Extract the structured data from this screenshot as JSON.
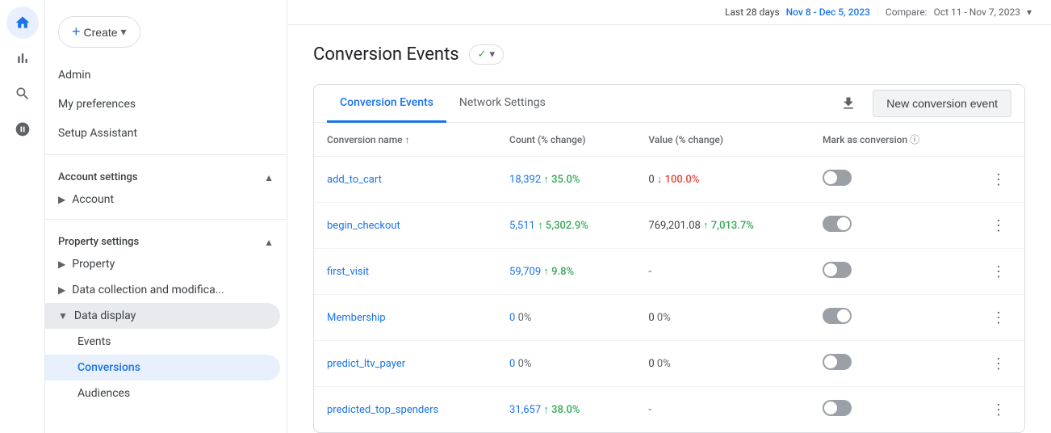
{
  "nav": {
    "icons": [
      {
        "name": "home-icon",
        "label": "Home",
        "active": true
      },
      {
        "name": "bar-chart-icon",
        "label": "Reports"
      },
      {
        "name": "search-icon",
        "label": "Explore"
      },
      {
        "name": "target-icon",
        "label": "Advertising"
      }
    ]
  },
  "sidebar": {
    "create_label": "Create",
    "menu_items": [
      {
        "label": "Admin",
        "name": "admin-menu-item"
      },
      {
        "label": "My preferences",
        "name": "my-preferences-menu-item"
      },
      {
        "label": "Setup Assistant",
        "name": "setup-assistant-menu-item"
      }
    ],
    "account_settings": {
      "header": "Account settings",
      "items": [
        {
          "label": "Account",
          "name": "account-item"
        }
      ]
    },
    "property_settings": {
      "header": "Property settings",
      "items": [
        {
          "label": "Property",
          "name": "property-item"
        },
        {
          "label": "Data collection and modifica...",
          "name": "data-collection-item"
        },
        {
          "label": "Data display",
          "name": "data-display-item",
          "expanded": true,
          "sub_items": [
            {
              "label": "Events",
              "name": "events-sub-item",
              "active": false
            },
            {
              "label": "Conversions",
              "name": "conversions-sub-item",
              "active": true
            },
            {
              "label": "Audiences",
              "name": "audiences-sub-item",
              "active": false
            }
          ]
        }
      ]
    }
  },
  "header": {
    "date_label": "Last 28 days",
    "date_range": "Nov 8 - Dec 5, 2023",
    "compare_label": "Compare:",
    "compare_range": "Oct 11 - Nov 7, 2023"
  },
  "page": {
    "title": "Conversion Events",
    "badge_label": "✓",
    "tabs": [
      {
        "label": "Conversion Events",
        "name": "conversion-events-tab",
        "active": true
      },
      {
        "label": "Network Settings",
        "name": "network-settings-tab",
        "active": false
      }
    ],
    "new_event_btn": "New conversion event",
    "table": {
      "columns": [
        {
          "label": "Conversion name ↑",
          "name": "col-conversion-name"
        },
        {
          "label": "Count (% change)",
          "name": "col-count"
        },
        {
          "label": "Value (% change)",
          "name": "col-value"
        },
        {
          "label": "Mark as conversion ⓘ",
          "name": "col-mark"
        }
      ],
      "rows": [
        {
          "name": "add_to_cart",
          "count": "18,392",
          "count_change": "↑ 35.0%",
          "count_change_type": "up",
          "value": "0",
          "value_change": "↓ 100.0%",
          "value_change_type": "down",
          "marked": false,
          "checked": true
        },
        {
          "name": "begin_checkout",
          "count": "5,511",
          "count_change": "↑ 5,302.9%",
          "count_change_type": "up",
          "value": "769,201.08",
          "value_change": "↑ 7,013.7%",
          "value_change_type": "up",
          "marked": true,
          "checked": true
        },
        {
          "name": "first_visit",
          "count": "59,709",
          "count_change": "↑ 9.8%",
          "count_change_type": "up",
          "value": "-",
          "value_change": "",
          "value_change_type": "none",
          "marked": false,
          "checked": true
        },
        {
          "name": "Membership",
          "count": "0",
          "count_change": "0%",
          "count_change_type": "neutral",
          "value": "0",
          "value_change": "0%",
          "value_change_type": "neutral",
          "marked": true,
          "checked": true
        },
        {
          "name": "predict_ltv_payer",
          "count": "0",
          "count_change": "0%",
          "count_change_type": "neutral",
          "value": "0",
          "value_change": "0%",
          "value_change_type": "neutral",
          "marked": false,
          "checked": true
        },
        {
          "name": "predicted_top_spenders",
          "count": "31,657",
          "count_change": "↑ 38.0%",
          "count_change_type": "up",
          "value": "-",
          "value_change": "",
          "value_change_type": "none",
          "marked": false,
          "checked": false
        }
      ]
    }
  }
}
